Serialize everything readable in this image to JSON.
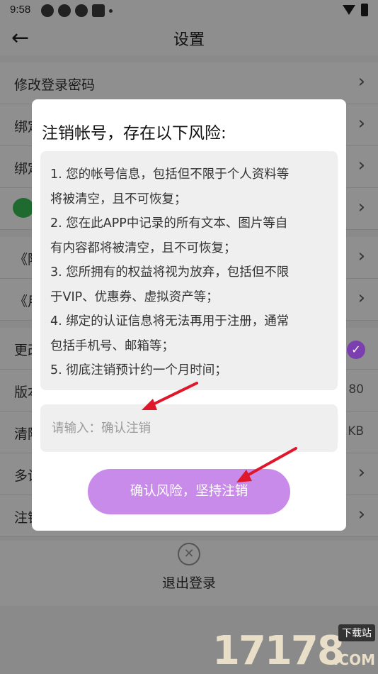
{
  "status_bar": {
    "time": "9:58"
  },
  "header": {
    "title": "设置",
    "back_icon": "arrow-left-icon"
  },
  "settings": {
    "rows": [
      {
        "label": "修改登录密码",
        "value": ""
      },
      {
        "label": "绑定",
        "value": ""
      },
      {
        "label": "绑定",
        "value": ""
      },
      {
        "label": "",
        "value": ""
      },
      {
        "label": "《隐",
        "value": ""
      },
      {
        "label": "《用",
        "value": ""
      },
      {
        "label": "更改",
        "value": ""
      },
      {
        "label": "版本",
        "value": "80"
      },
      {
        "label": "清除",
        "value": "KB"
      },
      {
        "label": "多设",
        "value": ""
      },
      {
        "label": "注销",
        "value": ""
      }
    ],
    "logout_label": "退出登录"
  },
  "modal": {
    "title": "注销帐号，存在以下风险:",
    "risk_lines": [
      "1. 您的帐号信息，包括但不限于个人资料等",
      "将被清空，且不可恢复；",
      "2. 您在此APP中记录的所有文本、图片等自",
      "有内容都将被清空，且不可恢复；",
      "3. 您所拥有的权益将视为放弃，包括但不限",
      "于VIP、优惠券、虚拟资产等；",
      "4. 绑定的认证信息将无法再用于注册，通常",
      "包括手机号、邮箱等；",
      "5. 彻底注销预计约一个月时间；"
    ],
    "input_placeholder": "请输入：确认注销",
    "input_value": "",
    "confirm_button": "确认风险，坚持注销"
  },
  "watermark": {
    "digits": "17178",
    "tag": "下载站",
    "suffix": ".COM"
  },
  "colors": {
    "accent": "#c98bea",
    "overlay": "#8a8a8a",
    "arrow": "#e0162b"
  }
}
